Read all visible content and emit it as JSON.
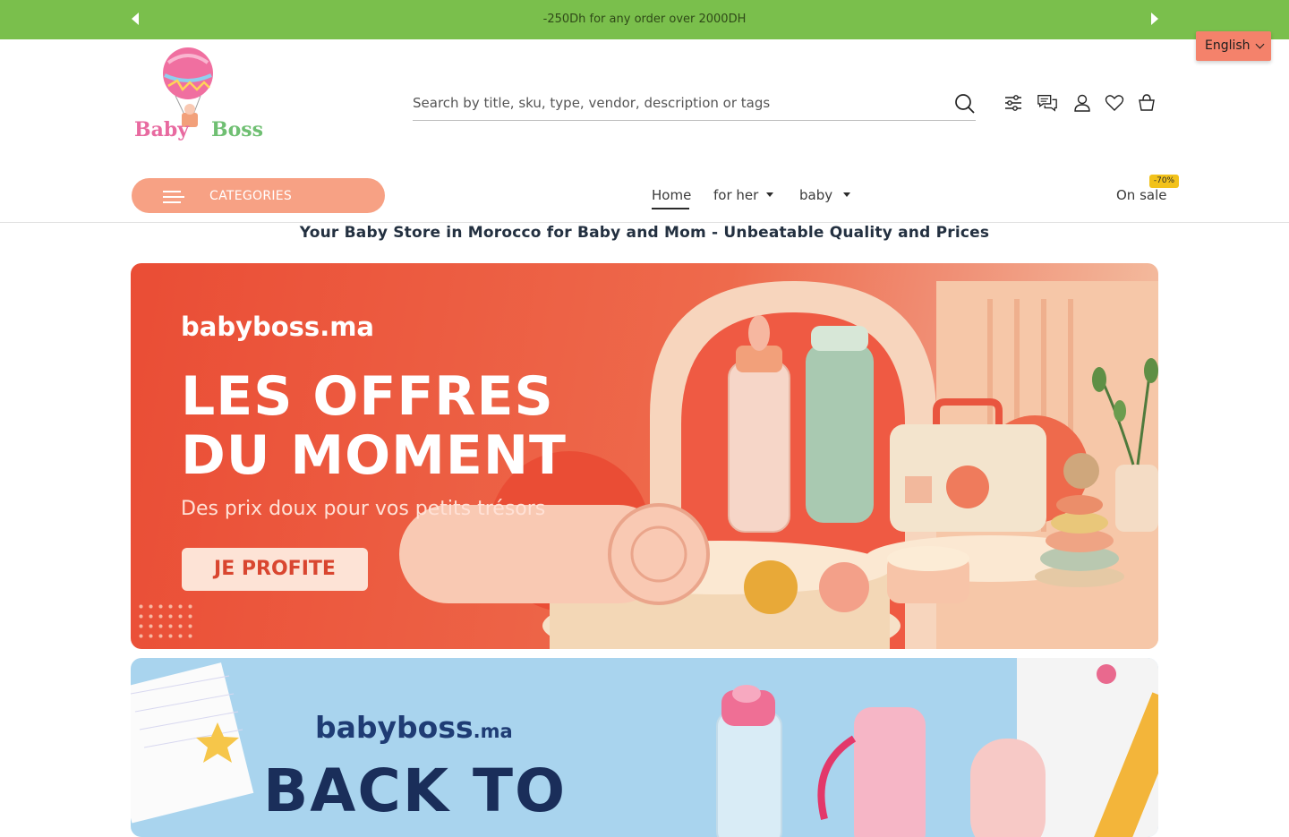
{
  "announcement": {
    "message": "-250Dh for any order over 2000DH",
    "prev_icon": "triangle-left-icon",
    "next_icon": "triangle-right-icon"
  },
  "language": {
    "selected": "English"
  },
  "logo": {
    "text_left": "Baby",
    "text_right": "Boss"
  },
  "search": {
    "placeholder": "Search by title, sku, type, vendor, description or tags",
    "value": ""
  },
  "header_icons": [
    "filter-sliders-icon",
    "chat-icon",
    "account-icon",
    "wishlist-heart-icon",
    "cart-icon"
  ],
  "nav": {
    "categories_label": "CATEGORIES",
    "items": [
      {
        "label": "Home",
        "active": true
      },
      {
        "label": "for her",
        "has_dropdown": true
      },
      {
        "label": "baby",
        "has_dropdown": true
      }
    ],
    "on_sale": {
      "label": "On sale",
      "badge": "-70%"
    }
  },
  "tagline": "Your Baby Store in Morocco for Baby and Mom - Unbeatable Quality and Prices",
  "banner1": {
    "brand": "babyboss.ma",
    "title_line1": "LES OFFRES",
    "title_line2": "DU MOMENT",
    "subtitle": "Des prix doux pour vos petits trésors",
    "cta": "JE PROFITE"
  },
  "banner2": {
    "brand": "babyboss",
    "brand_suffix": ".ma",
    "title": "BACK TO"
  },
  "colors": {
    "announcement_bg": "#7abf4c",
    "accent": "#f7a184",
    "language_bg": "#f4826b",
    "sale_badge": "#f2c21b",
    "banner1_bg": "#ea4d35",
    "banner2_bg": "#a9d4ee"
  }
}
